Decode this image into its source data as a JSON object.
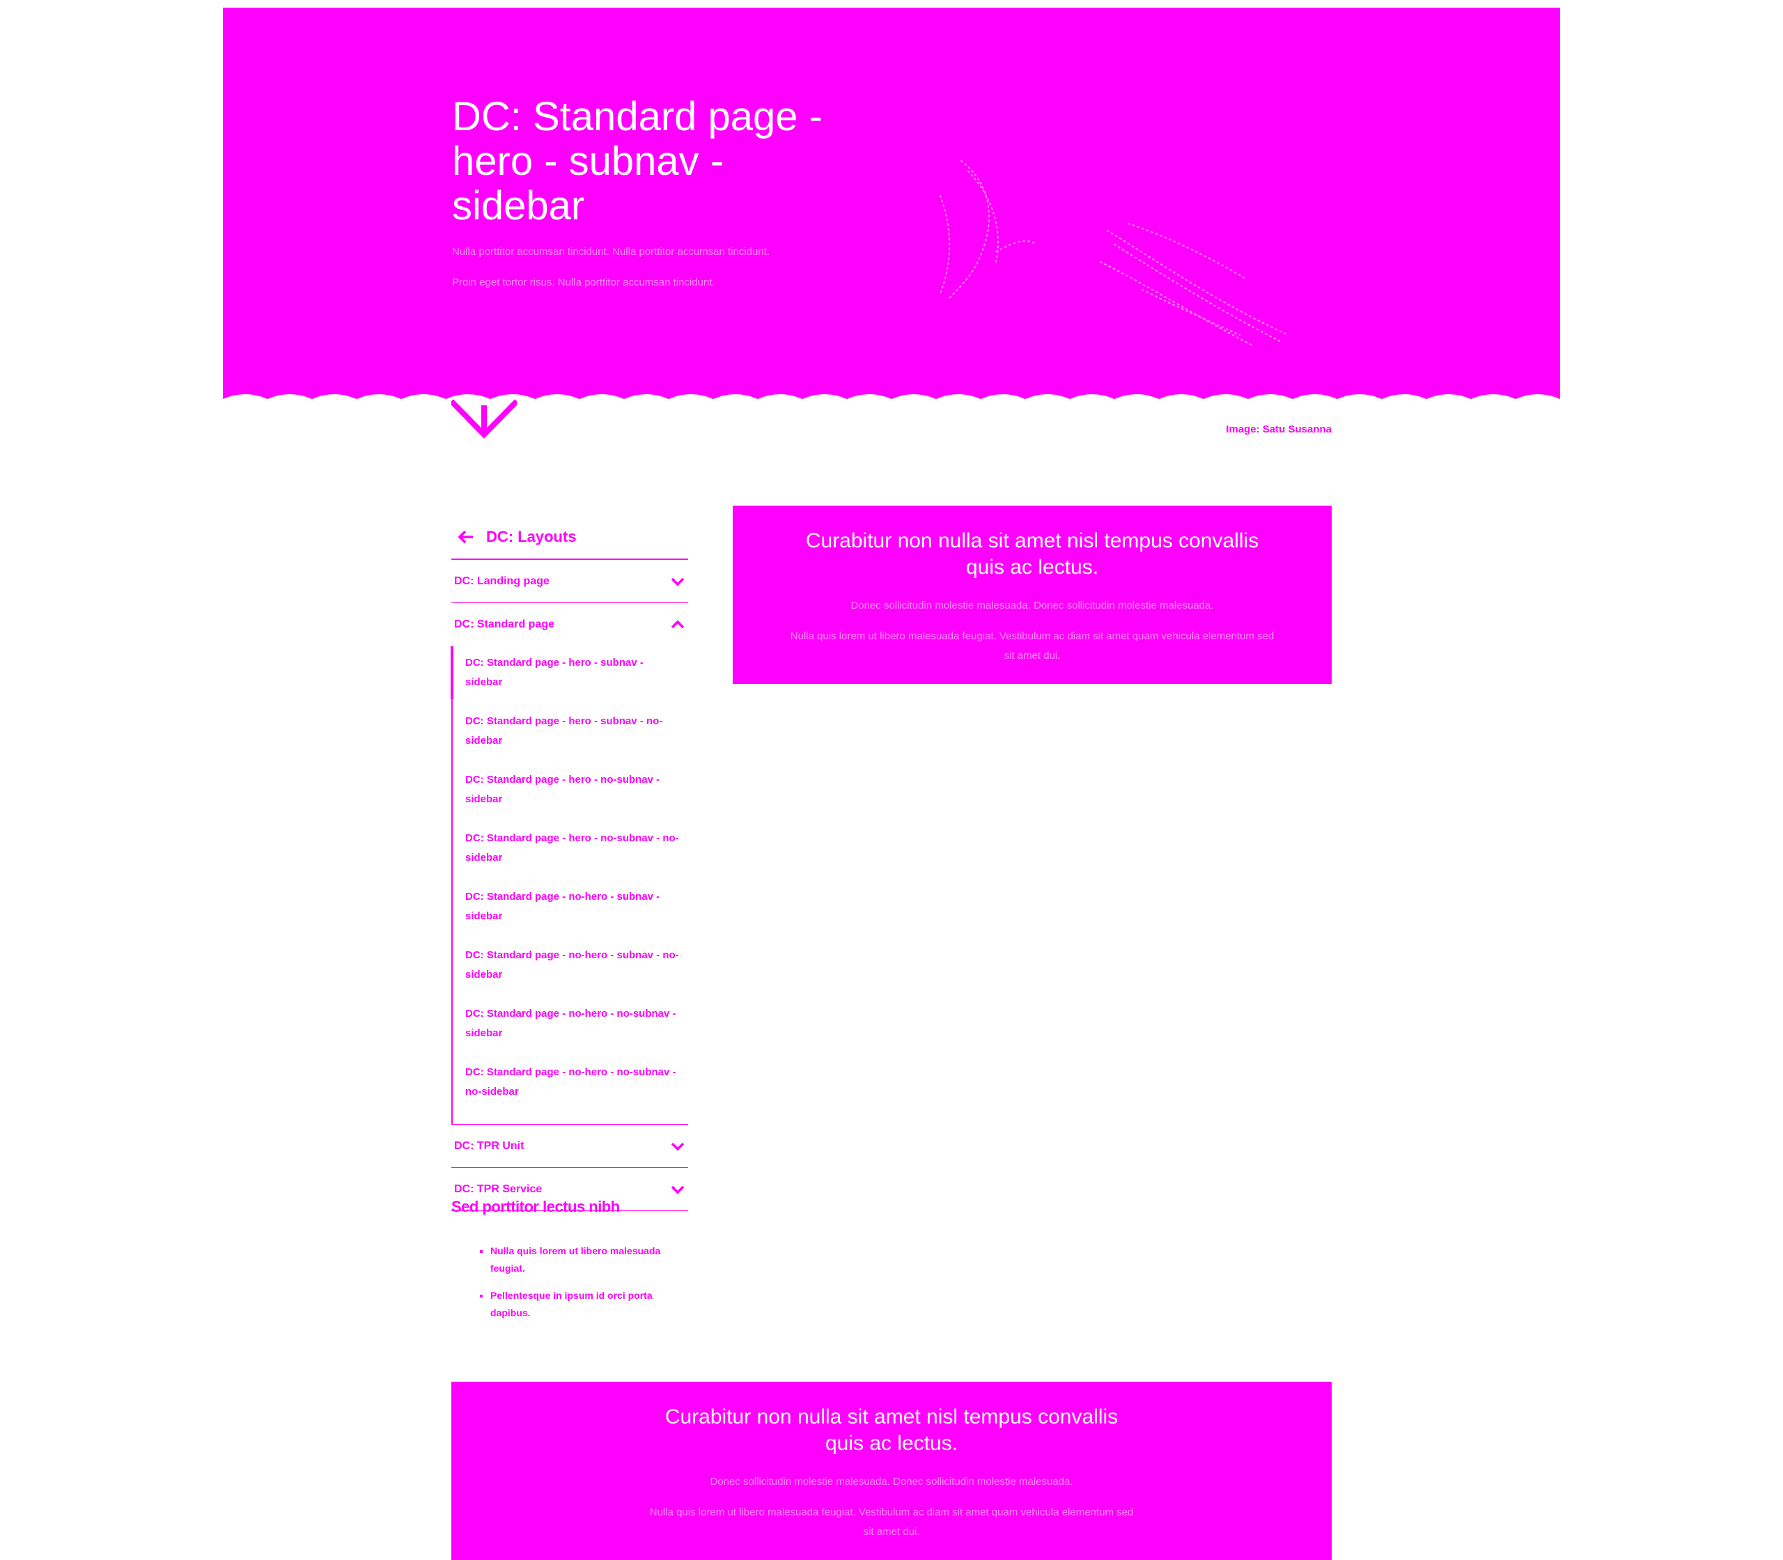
{
  "hero": {
    "title": "DC: Standard page - hero - subnav - sidebar",
    "text_1": "Nulla porttitor accumsan tincidunt. Nulla porttitor accumsan tincidunt.",
    "text_2": "Proin eget tortor risus. Nulla porttitor accumsan tincidunt.",
    "image_credit": "Image: Satu Susanna",
    "background_color": "#ff00ff",
    "arrow_icon": "chevron-down-icon"
  },
  "subnav": {
    "back_label": "DC: Layouts",
    "back_icon": "arrow-left-icon",
    "items": [
      {
        "label": "DC: Landing page",
        "state": "collapsed"
      },
      {
        "label": "DC: Standard page",
        "state": "expanded"
      },
      {
        "label": "DC: TPR Unit",
        "state": "collapsed"
      },
      {
        "label": "DC: TPR Service",
        "state": "collapsed"
      }
    ],
    "subitems": [
      {
        "label": "DC: Standard page - hero - subnav - sidebar",
        "active": true
      },
      {
        "label": "DC: Standard page - hero - subnav - no-sidebar",
        "active": false
      },
      {
        "label": "DC: Standard page - hero - no-subnav - sidebar",
        "active": false
      },
      {
        "label": "DC: Standard page - hero - no-subnav - no-sidebar",
        "active": false
      },
      {
        "label": "DC: Standard page - no-hero - subnav - sidebar",
        "active": false
      },
      {
        "label": "DC: Standard page - no-hero - subnav - no-sidebar",
        "active": false
      },
      {
        "label": "DC: Standard page - no-hero - no-subnav - sidebar",
        "active": false
      },
      {
        "label": "DC: Standard page - no-hero - no-subnav - no-sidebar",
        "active": false
      }
    ]
  },
  "sidebar": {
    "title": "Sed porttitor lectus nibh",
    "items": [
      "Nulla quis lorem ut libero malesuada feugiat.",
      "Pellentesque in ipsum id orci porta dapibus."
    ]
  },
  "lift_main": {
    "title": "Curabitur non nulla sit amet nisl tempus convallis quis ac lectus.",
    "text_1": "Donec sollicitudin molestie malesuada. Donec sollicitudin molestie malesuada.",
    "text_2": "Nulla quis lorem ut libero malesuada feugiat. Vestibulum ac diam sit amet quam vehicula elementum sed sit amet dui."
  },
  "lift_wide": {
    "title": "Curabitur non nulla sit amet nisl tempus convallis quis ac lectus.",
    "text_1": "Donec sollicitudin molestie malesuada. Donec sollicitudin molestie malesuada.",
    "text_2": "Nulla quis lorem ut libero malesuada feugiat. Vestibulum ac diam sit amet quam vehicula elementum sed sit amet dui."
  },
  "colors": {
    "accent": "#ff00ff",
    "background": "#ffffff",
    "on_accent_text": "#ffffff"
  }
}
